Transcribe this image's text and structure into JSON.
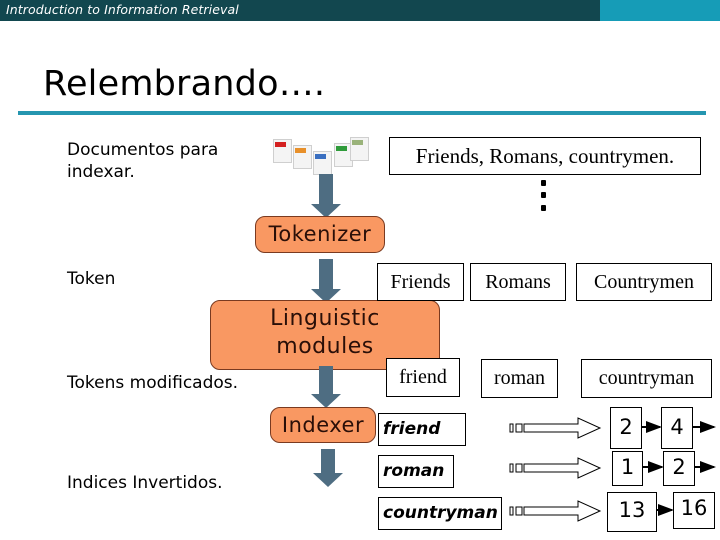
{
  "header": {
    "course_title": "Introduction to Information Retrieval",
    "bar_color": "#12474f",
    "accent_color": "#169cb7"
  },
  "slide": {
    "title": "Relembrando….",
    "rule_color": "#2596b0"
  },
  "left_labels": {
    "documents": "Documentos para indexar.",
    "documents_line1": "Documentos para",
    "documents_line2": "indexar.",
    "token": "Token",
    "modified_tokens": "Tokens modificados.",
    "inverted_index": "Indices Invertidos."
  },
  "document_icons": [
    "pdf-document-icon",
    "presentation-document-icon",
    "doc-document-icon",
    "spreadsheet-document-icon",
    "generic-document-icon"
  ],
  "input_text": "Friends, Romans, countrymen.",
  "stages": {
    "tokenizer": "Tokenizer",
    "linguistic_line1": "Linguistic",
    "linguistic_line2": "modules",
    "indexer": "Indexer",
    "box_color": "#f99862",
    "arrow_color": "#4e6d82"
  },
  "tokens": [
    "Friends",
    "Romans",
    "Countrymen"
  ],
  "modified_tokens": [
    "friend",
    "roman",
    "countryman"
  ],
  "index": [
    {
      "term": "friend",
      "postings": [
        "2",
        "4"
      ],
      "continues": true
    },
    {
      "term": "roman",
      "postings": [
        "1",
        "2"
      ],
      "continues": true
    },
    {
      "term": "countryman",
      "postings": [
        "13",
        "16"
      ],
      "continues": false
    }
  ]
}
